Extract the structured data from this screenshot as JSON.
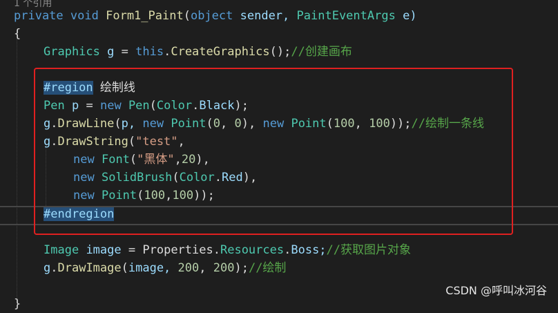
{
  "editor": {
    "refs_label": "1 个引用",
    "sig": {
      "kw1": "private",
      "kw2": "void",
      "method": "Form1_Paint",
      "p1": "(",
      "kw3": "object",
      "sender": "sender,",
      "type": "PaintEventArgs",
      "e": "e)"
    },
    "open_brace": "{",
    "graphics": {
      "type": "Graphics",
      "var": "g",
      "eq": "=",
      "kw": "this",
      "dot": ".",
      "fn": "CreateGraphics",
      "rest": "();",
      "comment": "//创建画布"
    },
    "region": {
      "tag": "#region",
      "label": "绘制线"
    },
    "pen": {
      "type": "Pen",
      "var": "p",
      "eq": "=",
      "kw": "new",
      "ctor": "Pen",
      "p1": "(",
      "color": "Color",
      "dot": ".",
      "member": "Black",
      "end": ");"
    },
    "drawline": {
      "obj": "g",
      "dot": ".",
      "fn": "DrawLine",
      "p1": "(",
      "arg": "p,",
      "kw": "new",
      "pt": "Point",
      "n0a": "0",
      "n0b": "0",
      "n100a": "100",
      "n100b": "100",
      "comment": "//绘制一条线"
    },
    "drawstring": {
      "obj": "g",
      "dot": ".",
      "fn": "DrawString",
      "p1": "(",
      "str": "\"test\"",
      "comma": ","
    },
    "font": {
      "kw": "new",
      "type": "Font",
      "p1": "(",
      "str": "\"黑体\"",
      "num": "20",
      "end": "),"
    },
    "brush": {
      "kw": "new",
      "type": "SolidBrush",
      "p1": "(",
      "color": "Color",
      "dot": ".",
      "member": "Red",
      "end": "),"
    },
    "point": {
      "kw": "new",
      "type": "Point",
      "n1": "100",
      "n2": "100",
      "end": "));"
    },
    "endregion": "#endregion",
    "image": {
      "type": "Image",
      "var": "image",
      "eq": "=",
      "cls": "Properties",
      "res": "Resources",
      "boss": "Boss;",
      "comment": "//获取图片对象"
    },
    "drawimage": {
      "obj": "g",
      "fn": "DrawImage",
      "arg": "image,",
      "n1": "200",
      "n2": "200",
      "comment": "//绘制"
    },
    "close_brace": "}"
  },
  "watermark": "CSDN @呼叫冰河谷",
  "colors": {
    "keyword": "#569cd6",
    "type": "#4ec9b0",
    "method": "#dcdcaa",
    "string": "#d69d85",
    "comment": "#57a64a",
    "number": "#b5cea8",
    "box": "#e02020"
  }
}
